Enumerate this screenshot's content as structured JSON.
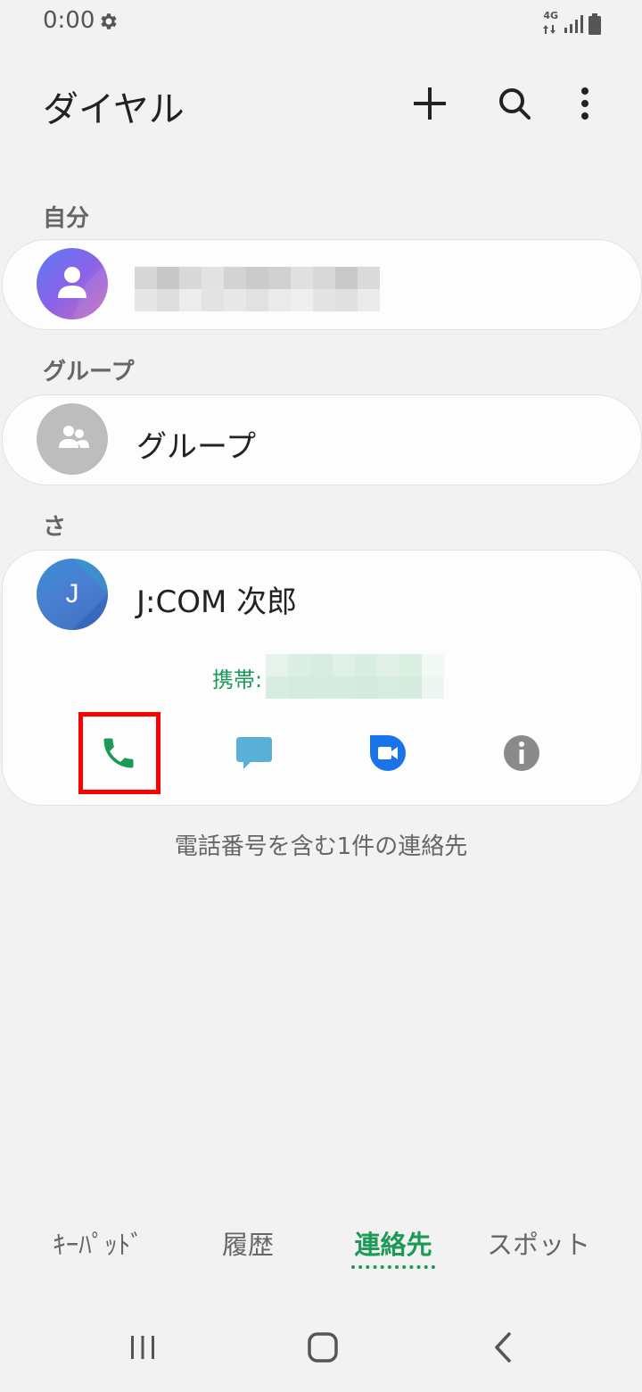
{
  "status": {
    "time": "0:00",
    "network": "4G"
  },
  "header": {
    "title": "ダイヤル",
    "add_icon": "plus-icon",
    "search_icon": "search-icon",
    "more_icon": "more-vert-icon"
  },
  "sections": {
    "me": {
      "label": "自分"
    },
    "groups": {
      "label": "グループ",
      "item_name": "グループ"
    },
    "sa": {
      "label": "さ"
    }
  },
  "contact": {
    "initial": "J",
    "name": "J:COM 次郎",
    "phone_label": "携帯:",
    "actions": [
      "phone-icon",
      "message-icon",
      "video-call-icon",
      "info-icon"
    ]
  },
  "summary": "電話番号を含む1件の連絡先",
  "tabs": [
    {
      "label": "ｷｰﾊﾟｯﾄﾞ",
      "active": false
    },
    {
      "label": "履歴",
      "active": false
    },
    {
      "label": "連絡先",
      "active": true
    },
    {
      "label": "スポット",
      "active": false
    }
  ],
  "colors": {
    "accent": "#1a9a55",
    "highlight": "#ff0000",
    "background": "#f2f2f2"
  }
}
